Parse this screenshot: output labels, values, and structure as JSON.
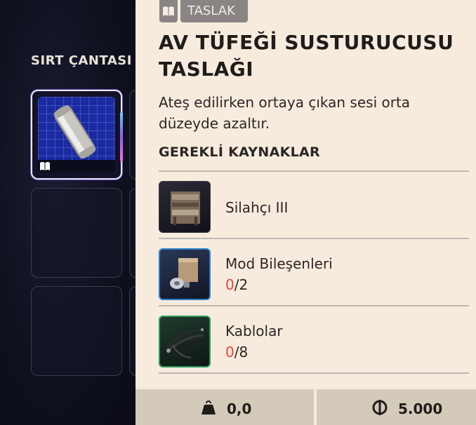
{
  "inventory": {
    "title": "SIRT ÇANTASI"
  },
  "badge": {
    "label": "TASLAK",
    "icon": "book-icon"
  },
  "item": {
    "title": "AV TÜFEĞİ SUSTURUCUSU TASLAĞI",
    "description": "Ateş edilirken ortaya çıkan sesi orta düzeyde azaltır."
  },
  "requirements": {
    "heading": "GEREKLİ KAYNAKLAR",
    "items": [
      {
        "name": "Silahçı III",
        "icon": "workbench-icon"
      },
      {
        "name": "Mod Bileşenleri",
        "have": "0",
        "need": "/2",
        "icon": "mod-components-icon"
      },
      {
        "name": "Kablolar",
        "have": "0",
        "need": "/8",
        "icon": "cables-icon"
      }
    ]
  },
  "footer": {
    "weight": "0,0",
    "weight_icon": "weight-icon",
    "price": "5.000",
    "currency_icon": "coin-icon"
  },
  "colors": {
    "panel_bg": "#f6ebdd",
    "accent_red": "#e2473b",
    "badge_bg": "#8a8584",
    "footer_bg": "#d4cab9"
  }
}
